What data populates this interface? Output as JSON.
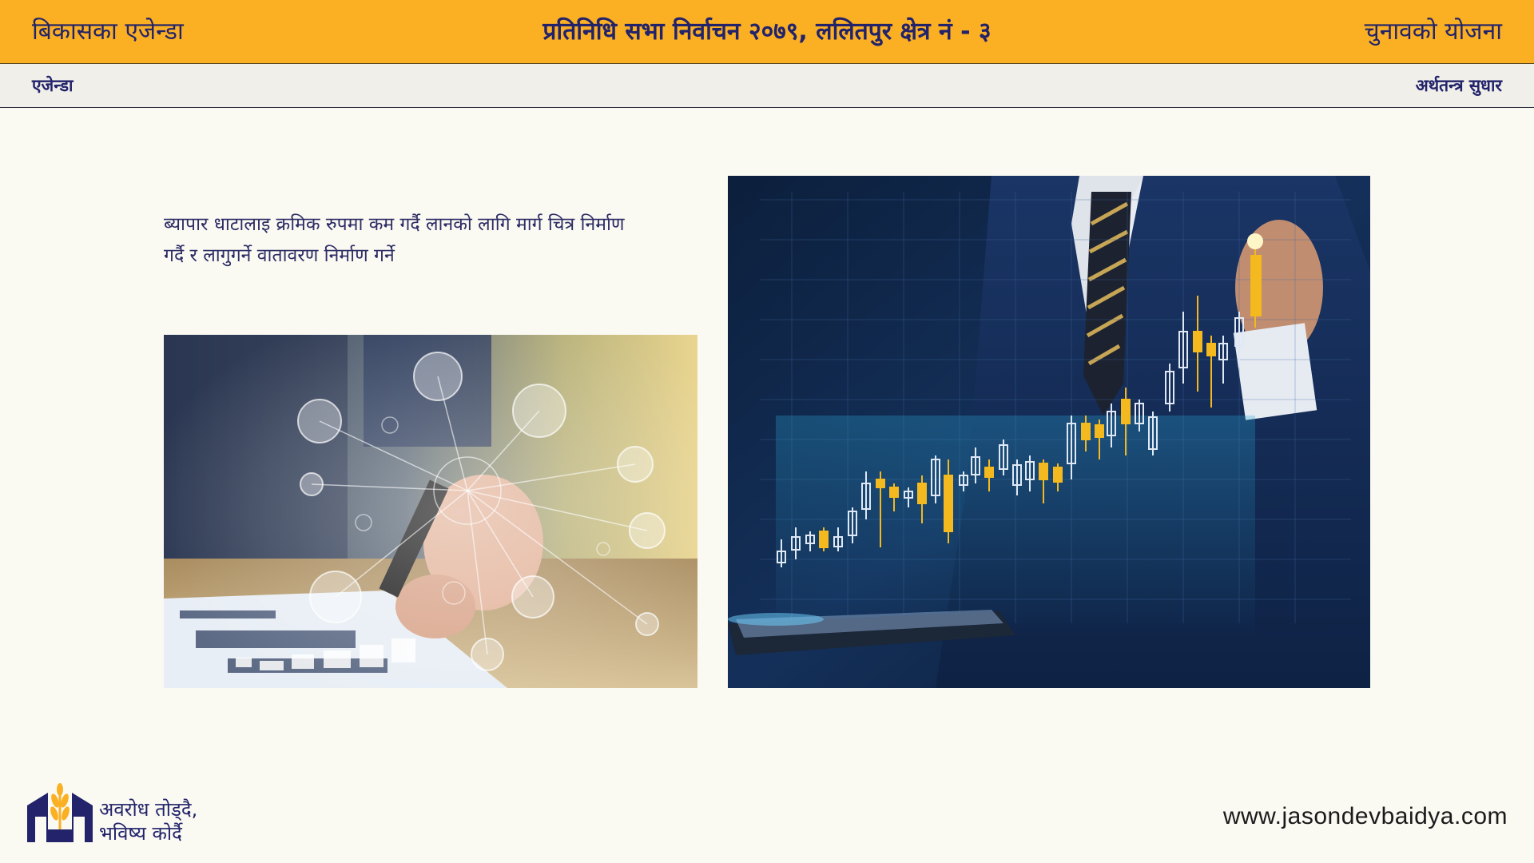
{
  "header": {
    "left_title": "बिकासका एजेन्डा",
    "center_title": "प्रतिनिधि सभा निर्वाचन २०७९, ललितपुर क्षेत्र नं - ३",
    "right_title": "चुनावको योजना"
  },
  "subheader": {
    "left_label": "एजेन्डा",
    "right_label": "अर्थतन्त्र सुधार"
  },
  "main": {
    "description_line1": "ब्यापार धाटालाइ क्रमिक रुपमा कम गर्दै लानको लागि मार्ग चित्र निर्माण",
    "description_line2": "गर्दै र लागुगर्ने वातावरण निर्माण गर्ने"
  },
  "footer": {
    "tagline_line1": "अवरोध तोड्दै,",
    "tagline_line2": "भविष्य कोर्दै",
    "website": "www.jasondevbaidya.com"
  },
  "colors": {
    "accent": "#fbb024",
    "navy": "#22236a",
    "background": "#faf9f2"
  }
}
